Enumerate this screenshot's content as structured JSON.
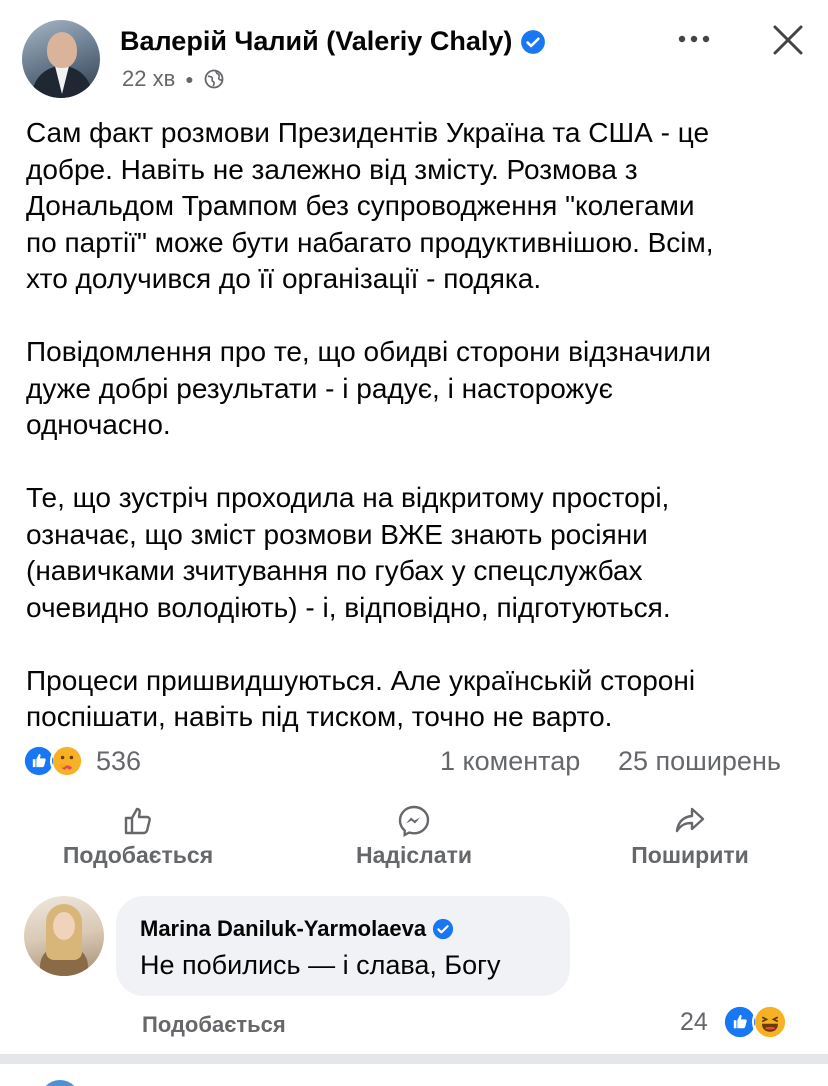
{
  "post": {
    "author": "Валерій Чалий (Valeriy Chaly)",
    "time": "22 хв",
    "paragraphs": [
      "Сам факт розмови Президентів Україна та США - це\nдобре. Навіть не залежно від змісту. Розмова з\nДональдом Трампом без супроводження \"колегами\nпо партії\" може бути набагато продуктивнішою. Всім,\nхто долучився до її організації - подяка.",
      "Повідомлення про те, що обидві сторони відзначили\nдуже добрі результати - і радує, і насторожує\nодночасно.",
      "Те, що зустріч проходила на відкритому просторі,\nозначає, що зміст розмови ВЖЕ знають росіяни\n(навичками зчитування по губах у спецслужбах\nочевидно володіють) - і, відповідно, підготуються.",
      "Процеси пришвидшуються. Але українській стороні\nпоспішати, навіть під тиском, точно не варто."
    ]
  },
  "stats": {
    "reactions": "536",
    "comments": "1 коментар",
    "shares": "25 поширень"
  },
  "actions": {
    "like": "Подобається",
    "send": "Надіслати",
    "share": "Поширити"
  },
  "comment": {
    "author": "Marina Daniluk-Yarmolaeva",
    "text": "Не побились — і слава, Богу",
    "like_label": "Подобається",
    "reactions": "24"
  },
  "colors": {
    "verified": "#1877f2",
    "secondary_text": "#65676b",
    "bubble": "#f0f2f5"
  },
  "icons": [
    "verified-badge-icon",
    "globe-icon",
    "more-icon",
    "close-icon",
    "like-reaction-icon",
    "care-reaction-icon",
    "haha-reaction-icon",
    "thumbs-up-icon",
    "messenger-icon",
    "share-arrow-icon"
  ]
}
